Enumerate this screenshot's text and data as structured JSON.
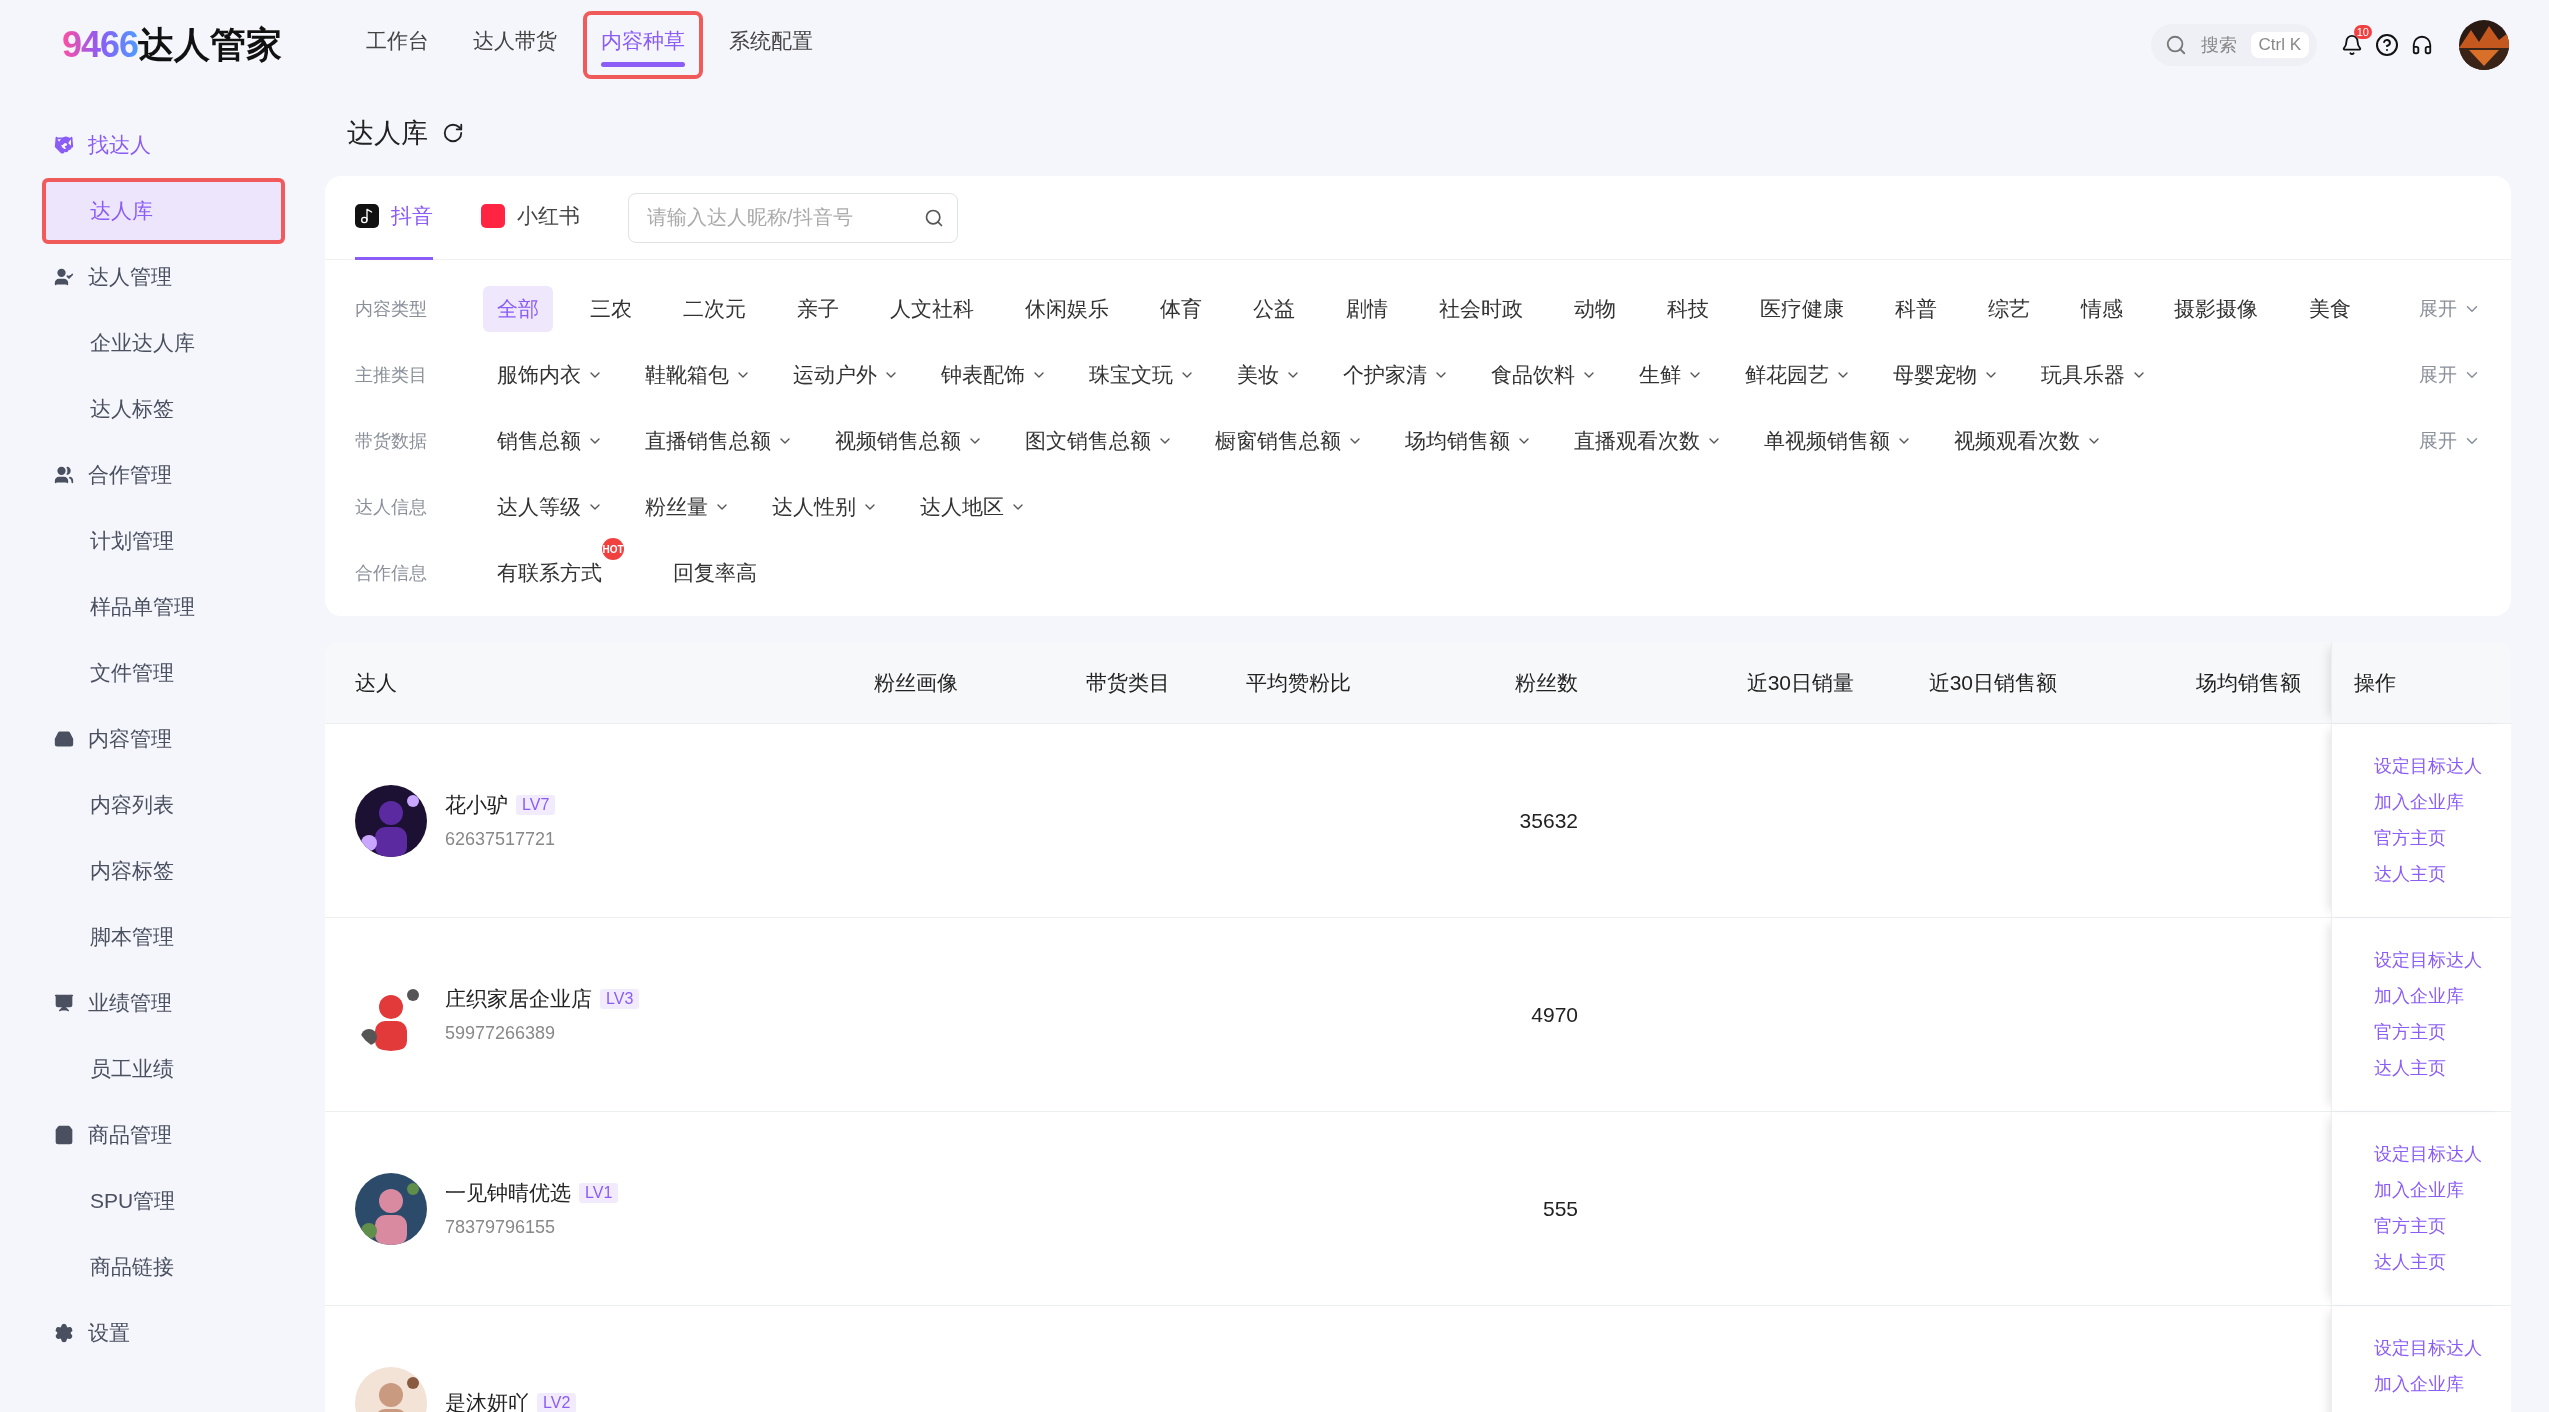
{
  "brand": {
    "number": "9466",
    "name": "达人管家"
  },
  "top_nav": [
    {
      "label": "工作台",
      "selected": false,
      "highlighted": false
    },
    {
      "label": "达人带货",
      "selected": false,
      "highlighted": false
    },
    {
      "label": "内容种草",
      "selected": true,
      "highlighted": true
    },
    {
      "label": "系统配置",
      "selected": false,
      "highlighted": false
    }
  ],
  "global_search": {
    "placeholder": "搜索",
    "shortcut": "Ctrl K"
  },
  "notifications": {
    "count": "10"
  },
  "sidebar": [
    {
      "label": "找达人",
      "active": true,
      "children": [
        {
          "label": "达人库",
          "selected": true,
          "highlighted": true
        }
      ]
    },
    {
      "label": "达人管理",
      "active": false,
      "children": [
        {
          "label": "企业达人库",
          "selected": false,
          "highlighted": false
        },
        {
          "label": "达人标签",
          "selected": false,
          "highlighted": false
        }
      ]
    },
    {
      "label": "合作管理",
      "active": false,
      "children": [
        {
          "label": "计划管理",
          "selected": false,
          "highlighted": false
        },
        {
          "label": "样品单管理",
          "selected": false,
          "highlighted": false
        },
        {
          "label": "文件管理",
          "selected": false,
          "highlighted": false
        }
      ]
    },
    {
      "label": "内容管理",
      "active": false,
      "children": [
        {
          "label": "内容列表",
          "selected": false,
          "highlighted": false
        },
        {
          "label": "内容标签",
          "selected": false,
          "highlighted": false
        },
        {
          "label": "脚本管理",
          "selected": false,
          "highlighted": false
        }
      ]
    },
    {
      "label": "业绩管理",
      "active": false,
      "children": [
        {
          "label": "员工业绩",
          "selected": false,
          "highlighted": false
        }
      ]
    },
    {
      "label": "商品管理",
      "active": false,
      "children": [
        {
          "label": "SPU管理",
          "selected": false,
          "highlighted": false
        },
        {
          "label": "商品链接",
          "selected": false,
          "highlighted": false
        }
      ]
    },
    {
      "label": "设置",
      "active": false
    }
  ],
  "page_title": "达人库",
  "platform_tabs": [
    {
      "label": "抖音",
      "selected": true
    },
    {
      "label": "小红书",
      "selected": false
    }
  ],
  "creator_search": {
    "placeholder": "请输入达人昵称/抖音号"
  },
  "filters": [
    {
      "label": "内容类型",
      "kind": "tags",
      "expand": "展开",
      "options": [
        {
          "label": "全部",
          "selected": true
        },
        {
          "label": "三农",
          "selected": false
        },
        {
          "label": "二次元",
          "selected": false
        },
        {
          "label": "亲子",
          "selected": false
        },
        {
          "label": "人文社科",
          "selected": false
        },
        {
          "label": "休闲娱乐",
          "selected": false
        },
        {
          "label": "体育",
          "selected": false
        },
        {
          "label": "公益",
          "selected": false
        },
        {
          "label": "剧情",
          "selected": false
        },
        {
          "label": "社会时政",
          "selected": false
        },
        {
          "label": "动物",
          "selected": false
        },
        {
          "label": "科技",
          "selected": false
        },
        {
          "label": "医疗健康",
          "selected": false
        },
        {
          "label": "科普",
          "selected": false
        },
        {
          "label": "综艺",
          "selected": false
        },
        {
          "label": "情感",
          "selected": false
        },
        {
          "label": "摄影摄像",
          "selected": false
        },
        {
          "label": "美食",
          "selected": false
        }
      ]
    },
    {
      "label": "主推类目",
      "kind": "dropdowns",
      "expand": "展开",
      "options": [
        {
          "label": "服饰内衣"
        },
        {
          "label": "鞋靴箱包"
        },
        {
          "label": "运动户外"
        },
        {
          "label": "钟表配饰"
        },
        {
          "label": "珠宝文玩"
        },
        {
          "label": "美妆"
        },
        {
          "label": "个护家清"
        },
        {
          "label": "食品饮料"
        },
        {
          "label": "生鲜"
        },
        {
          "label": "鲜花园艺"
        },
        {
          "label": "母婴宠物"
        },
        {
          "label": "玩具乐器"
        }
      ]
    },
    {
      "label": "带货数据",
      "kind": "dropdowns",
      "expand": "展开",
      "options": [
        {
          "label": "销售总额"
        },
        {
          "label": "直播销售总额"
        },
        {
          "label": "视频销售总额"
        },
        {
          "label": "图文销售总额"
        },
        {
          "label": "橱窗销售总额"
        },
        {
          "label": "场均销售额"
        },
        {
          "label": "直播观看次数"
        },
        {
          "label": "单视频销售额"
        },
        {
          "label": "视频观看次数"
        }
      ]
    },
    {
      "label": "达人信息",
      "kind": "dropdowns",
      "options": [
        {
          "label": "达人等级"
        },
        {
          "label": "粉丝量"
        },
        {
          "label": "达人性别"
        },
        {
          "label": "达人地区"
        }
      ]
    },
    {
      "label": "合作信息",
      "kind": "toggles",
      "options": [
        {
          "label": "有联系方式",
          "badge": "HOT"
        },
        {
          "label": "回复率高"
        }
      ]
    }
  ],
  "table": {
    "columns": [
      "达人",
      "粉丝画像",
      "带货类目",
      "平均赞粉比",
      "粉丝数",
      "近30日销量",
      "近30日销售额",
      "场均销售额",
      "操作"
    ],
    "rows": [
      {
        "name": "花小驴",
        "grade": "LV7",
        "id": "62637517721",
        "fans": "35632",
        "actions": [
          "设定目标达人",
          "加入企业库",
          "官方主页",
          "达人主页"
        ]
      },
      {
        "name": "庄织家居企业店",
        "grade": "LV3",
        "id": "59977266389",
        "fans": "4970",
        "actions": [
          "设定目标达人",
          "加入企业库",
          "官方主页",
          "达人主页"
        ]
      },
      {
        "name": "一见钟晴优选",
        "grade": "LV1",
        "id": "78379796155",
        "fans": "555",
        "actions": [
          "设定目标达人",
          "加入企业库",
          "官方主页",
          "达人主页"
        ]
      },
      {
        "name": "是沐妍吖",
        "grade": "LV2",
        "actions": [
          "设定目标达人",
          "加入企业库"
        ]
      }
    ]
  }
}
